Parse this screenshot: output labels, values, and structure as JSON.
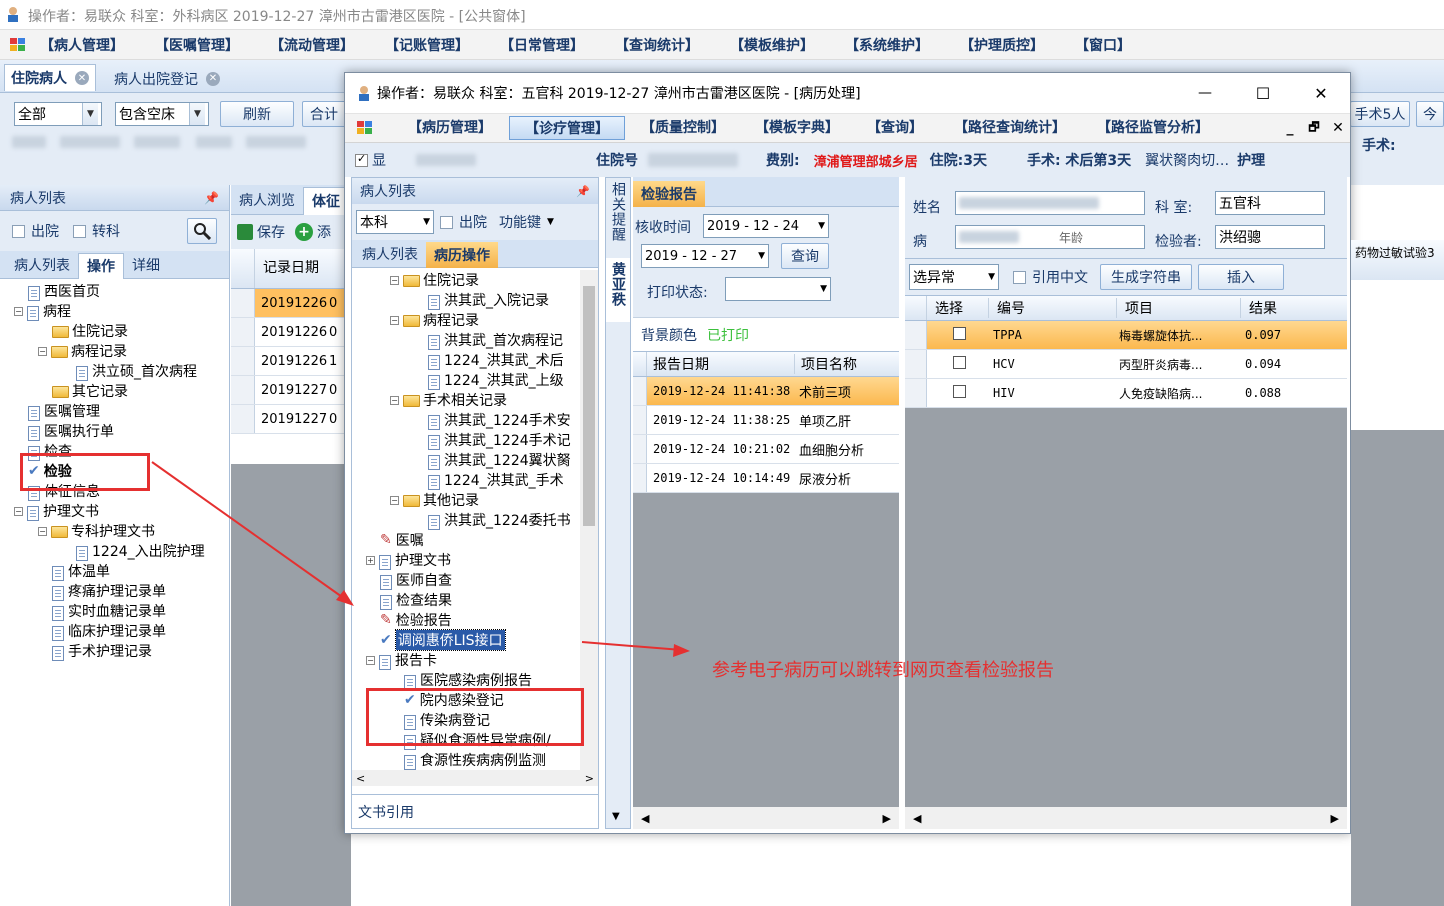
{
  "main_window": {
    "title": "操作者：易联众 科室：外科病区 2019-12-27 漳州市古雷港区医院 - [公共窗体]",
    "menu": [
      "【病人管理】",
      "【医嘱管理】",
      "【流动管理】",
      "【记账管理】",
      "【日常管理】",
      "【查询统计】",
      "【模板维护】",
      "【系统维护】",
      "【护理质控】",
      "【窗口】"
    ],
    "tabs": [
      "住院病人",
      "病人出院登记"
    ],
    "filter_all": "全部",
    "filter_empty_bed": "包含空床",
    "refresh": "刷新",
    "total": "合计",
    "right_btn1": "手术5人",
    "right_btn2": "今",
    "right_label": "手术:",
    "patient_list_title": "病人列表",
    "discharge": "出院",
    "transfer": "转科",
    "subtabs": [
      "病人列表",
      "操作",
      "详细"
    ],
    "browse_tabs": [
      "病人浏览",
      "体征"
    ],
    "save": "保存",
    "add_short": "添",
    "tree": [
      "西医首页",
      "病程",
      "住院记录",
      "病程记录",
      "洪立硕_首次病程",
      "其它记录",
      "医嘱管理",
      "医嘱执行单",
      "检查",
      "检验",
      "体征信息",
      "护理文书",
      "专科护理文书",
      "1224_入出院护理",
      "体温单",
      "疼痛护理记录单",
      "实时血糖记录单",
      "临床护理记录单",
      "手术护理记录"
    ],
    "grid_header": "记录日期",
    "grid_dates": [
      "20191226",
      "20191226",
      "20191226",
      "20191227",
      "20191227"
    ],
    "grid_col2": [
      "0",
      "0",
      "1",
      "0",
      "0"
    ]
  },
  "dialog": {
    "title": "操作者：易联众 科室：五官科 2019-12-27 漳州市古雷港区医院 - [病历处理]",
    "controls": {
      "min": "—",
      "max": "☐",
      "close": "✕"
    },
    "menu": [
      "【病历管理】",
      "【诊疗管理】",
      "【质量控制】",
      "【模板字典】",
      "【查询】",
      "【路径查询统计】",
      "【路径监管分析】"
    ],
    "info_show": "显",
    "info_inpatient_no": "住院号",
    "info_fee_label": "费别:",
    "info_fee_value": "漳浦管理部城乡居",
    "info_stay": "住院:3天",
    "info_surgery": "手术: 术后第3天",
    "info_surgery_detail": "翼状胬肉切…",
    "info_nursing": "护理",
    "left_panel_title": "病人列表",
    "dept_select": "本科",
    "discharge": "出院",
    "function_key": "功能键",
    "left_tabs": [
      "病人列表",
      "病历操作"
    ],
    "tree": [
      "住院记录",
      "洪其武_入院记录",
      "病程记录",
      "洪其武_首次病程记",
      "1224_洪其武_术后",
      "1224_洪其武_上级",
      "手术相关记录",
      "洪其武_1224手术安",
      "洪其武_1224手术记",
      "洪其武_1224翼状胬",
      "1224_洪其武_手术",
      "其他记录",
      "洪其武_1224委托书",
      "医嘱",
      "护理文书",
      "医师自查",
      "检查结果",
      "检验报告",
      "调阅惠侨LIS接口",
      "报告卡",
      "医院感染病例报告",
      "院内感染登记",
      "传染病登记",
      "疑似食源性异常病例/",
      "食源性疾病病例监测"
    ],
    "doc_ref": "文书引用",
    "side_tabs": [
      "相关提醒",
      "黄亚秩"
    ],
    "report_tab": "检验报告",
    "receive_time_label": "核收时间",
    "date_from": "2019 - 12 - 24",
    "date_to": "2019 - 12 - 27",
    "query": "查询",
    "print_status": "打印状态:",
    "bg_color": "背景颜色",
    "printed": "已打印",
    "report_cols": [
      "报告日期",
      "项目名称"
    ],
    "reports": [
      {
        "date": "2019-12-24 11:41:38",
        "name": "术前三项"
      },
      {
        "date": "2019-12-24 11:38:25",
        "name": "单项乙肝"
      },
      {
        "date": "2019-12-24 10:21:02",
        "name": "血细胞分析"
      },
      {
        "date": "2019-12-24 10:14:49",
        "name": "尿液分析"
      }
    ],
    "name_label": "姓名",
    "dept_label": "科   室:",
    "dept_value": "五官科",
    "bed_label": "病",
    "age_label": "年龄",
    "examiner_label": "检验者:",
    "examiner_value": "洪绍骢",
    "far_right_label": "药物过敏试验3",
    "abnormal_select": "选异常",
    "cite_chinese": "引用中文",
    "gen_string": "生成字符串",
    "insert": "插入",
    "result_cols": [
      "选择",
      "编号",
      "项目",
      "结果"
    ],
    "results": [
      {
        "code": "TPPA",
        "item": "梅毒螺旋体抗...",
        "value": "0.097"
      },
      {
        "code": "HCV",
        "item": "丙型肝炎病毒...",
        "value": "0.094"
      },
      {
        "code": "HIV",
        "item": "人免疫缺陷病...",
        "value": "0.088"
      }
    ]
  },
  "annotation": "参考电子病历可以跳转到网页查看检验报告",
  "colors": {
    "highlight": "#ffc060",
    "selected_row": "#fbe3b4",
    "title_blue": "#1a3a6a",
    "accent_red": "#e03030",
    "fee_red": "#e01818",
    "link_green": "#3cc03c"
  }
}
